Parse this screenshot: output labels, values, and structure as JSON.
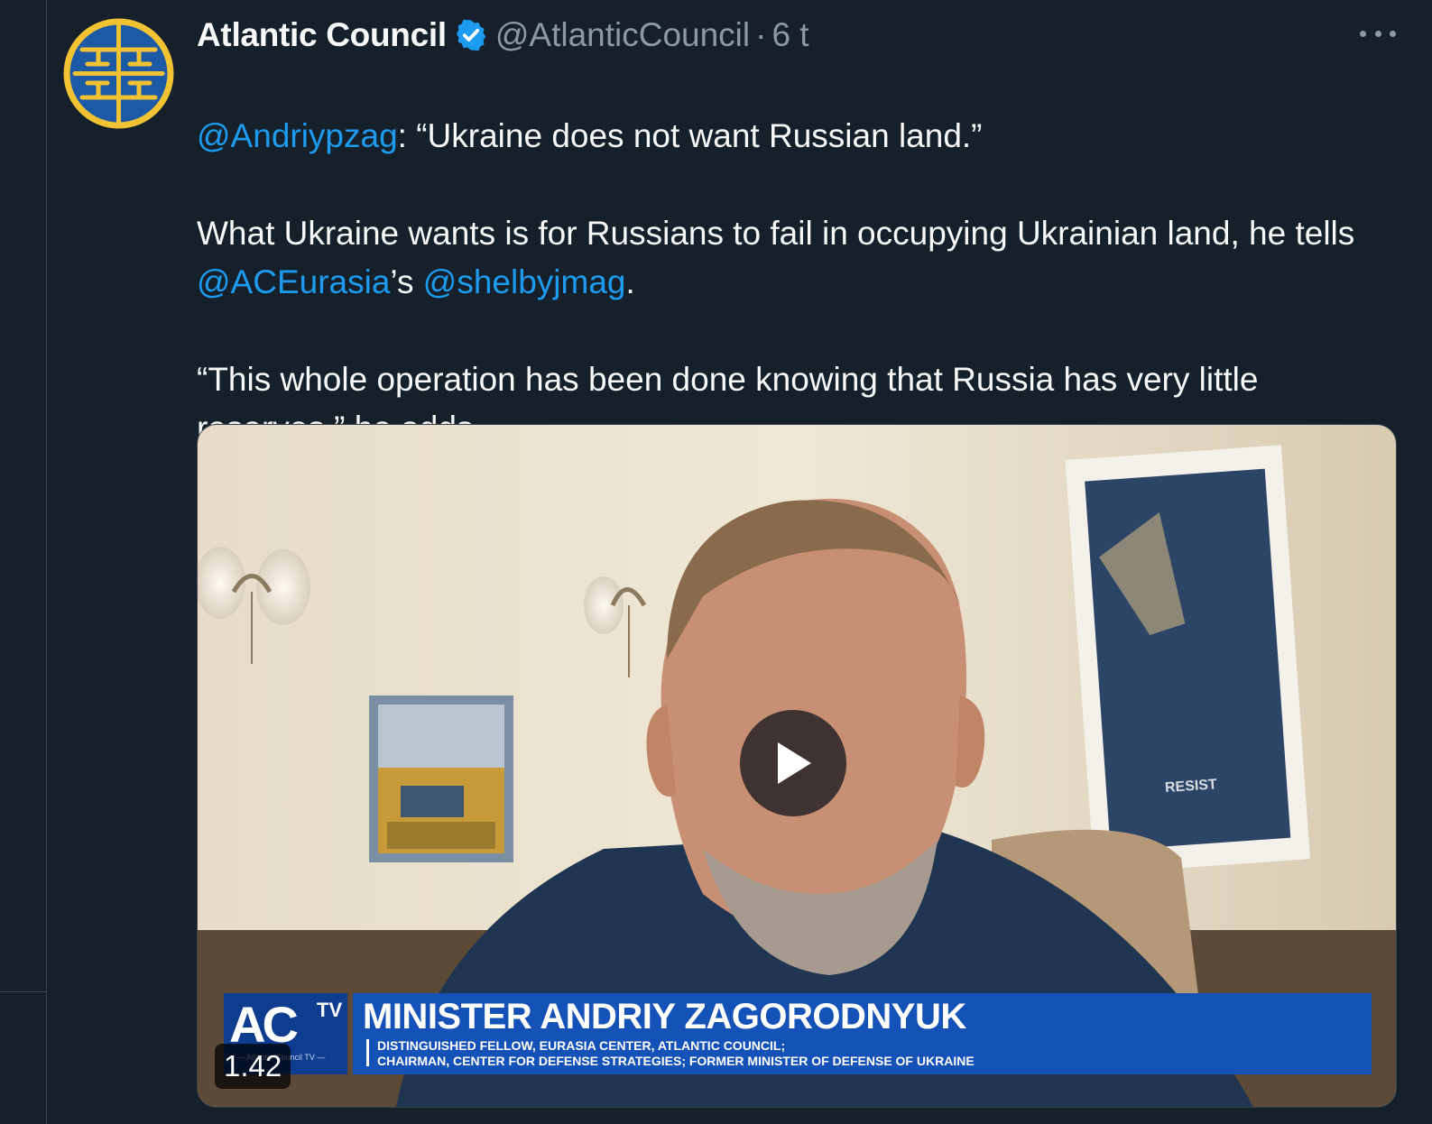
{
  "tweet": {
    "display_name": "Atlantic Council",
    "handle": "@AtlanticCouncil",
    "separator": "·",
    "time": "6 t",
    "body": {
      "p1_mention": "@Andriypzag",
      "p1_text": ": “Ukraine does not want Russian land.”",
      "p2_text_a": "What Ukraine wants is for Russians to fail in occupying Ukrainian land, he tells ",
      "p2_mention_a": "@ACEurasia",
      "p2_text_b": "’s ",
      "p2_mention_b": "@shelbyjmag",
      "p2_text_c": ".",
      "p3_text": "“This whole operation has been done knowing that Russia has very little reserves,” he adds."
    },
    "video": {
      "duration": "1.42",
      "logo_text": "AC",
      "logo_tv": "TV",
      "logo_sub": "— Atlantic Council TV —",
      "guest_name": "MINISTER ANDRIY ZAGORODNYUK",
      "guest_title_1": "DISTINGUISHED FELLOW, EURASIA CENTER, ATLANTIC COUNCIL;",
      "guest_title_2": "CHAIRMAN, CENTER FOR DEFENSE STRATEGIES; FORMER MINISTER OF DEFENSE OF UKRAINE",
      "poster_text": "RESIST"
    }
  },
  "colors": {
    "background": "#15202b",
    "link": "#1d9bf0",
    "muted": "#8b98a5",
    "verified": "#1d9bf0",
    "flag_blue": "#1f6fd1",
    "flag_yellow": "#f5cc1f"
  },
  "icons": [
    "avatar-logo-icon",
    "verified-badge-icon",
    "more-options-icon",
    "ukraine-flag-icon",
    "play-icon"
  ]
}
